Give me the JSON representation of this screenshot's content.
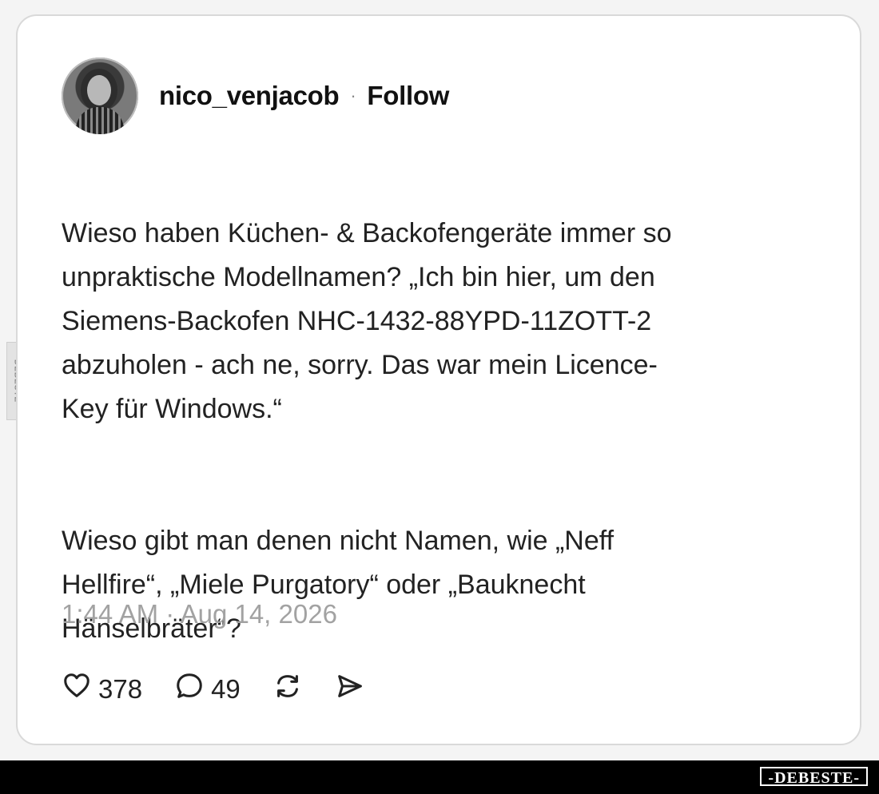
{
  "post": {
    "username": "nico_venjacob",
    "separator": "·",
    "follow_label": "Follow",
    "paragraphs": [
      "Wieso haben Küchen- & Backofengeräte immer so\nunpraktische Modellnamen? „Ich bin hier, um den\nSiemens-Backofen NHC-1432-88YPD-11ZOTT-2\nabzuholen - ach ne, sorry. Das war mein Licence-\nKey für Windows.“",
      "Wieso gibt man denen nicht Namen, wie „Neff\nHellfire“, „Miele Purgatory“ oder „Bauknecht\nHänselbräter“?"
    ],
    "timestamp": "1:44 AM · Aug 14, 2026",
    "likes": "378",
    "comments": "49"
  },
  "watermarks": {
    "side": "DEBESTE",
    "footer": "-DEBESTE-"
  },
  "icons": {
    "like": "heart-icon",
    "comment": "comment-icon",
    "repost": "repost-icon",
    "share": "send-icon"
  }
}
